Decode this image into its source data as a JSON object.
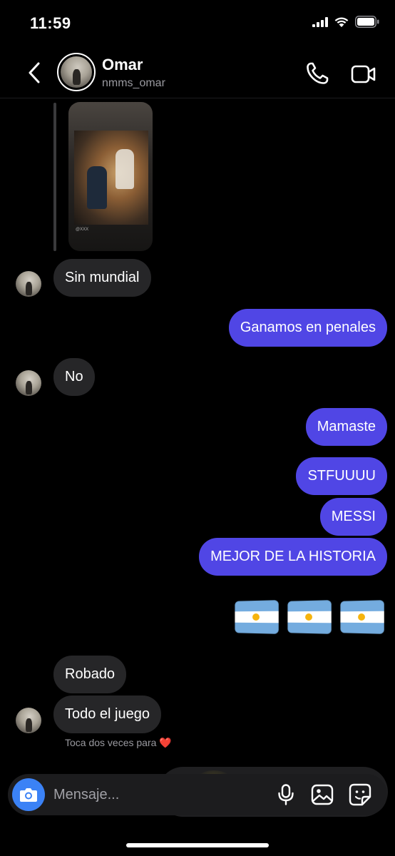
{
  "status_bar": {
    "time": "11:59"
  },
  "header": {
    "name": "Omar",
    "handle": "nmms_omar"
  },
  "shared_post": {
    "caption": "@XXX"
  },
  "messages": [
    {
      "text": "Sin mundial"
    },
    {
      "text": "Ganamos en penales"
    },
    {
      "text": "No"
    },
    {
      "text": "Mamaste"
    },
    {
      "text": "STFUUUU"
    },
    {
      "text": "MESSI"
    },
    {
      "text": "MEJOR DE LA HISTORIA"
    },
    {
      "text": "🇦🇷 🇦🇷 🇦🇷"
    },
    {
      "text": "Robado"
    },
    {
      "text": "Todo el juego"
    }
  ],
  "hint": {
    "text": "Toca dos veces para",
    "heart": "❤️"
  },
  "composer": {
    "placeholder": "Mensaje..."
  },
  "colors": {
    "outgoing": "#5046e5",
    "incoming": "#262628",
    "camera": "#3b82f6"
  },
  "icons": [
    "back-icon",
    "phone-icon",
    "video-camera-icon",
    "camera-icon",
    "microphone-icon",
    "gallery-icon",
    "sticker-icon"
  ]
}
